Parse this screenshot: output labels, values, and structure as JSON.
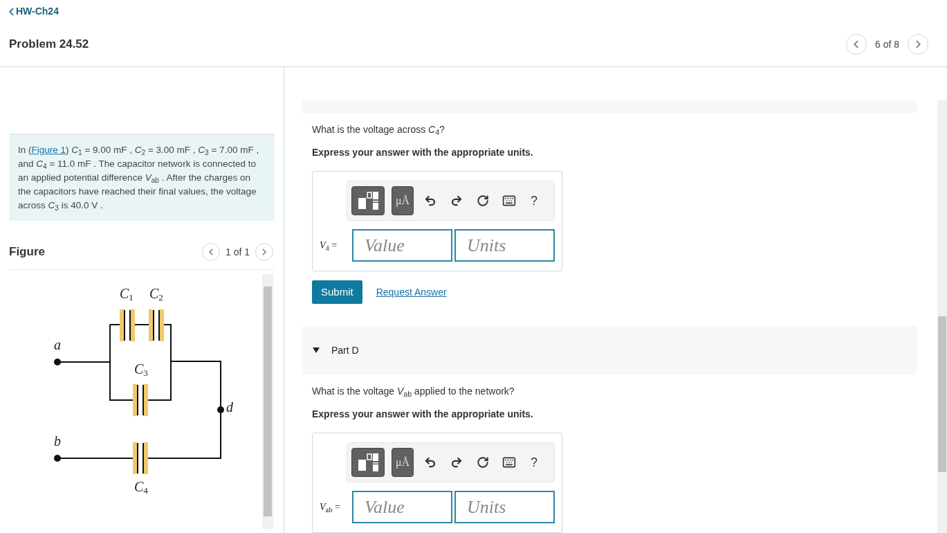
{
  "breadcrumb": "HW-Ch24",
  "problem_title": "Problem 24.52",
  "pager": "6 of 8",
  "problem": {
    "intro": "In (",
    "link": "Figure 1",
    "rest": ") *C*$_{1}$ = 9.00 mF , *C*$_{2}$ = 3.00 mF , *C*$_{3}$ = 7.00 mF , and *C*$_{4}$ = 11.0 mF . The capacitor network is connected to an applied potential difference *V*$_{ab}$ . After the charges on the capacitors have reached their final values, the voltage across *C*$_{3}$ is 40.0 V ."
  },
  "figure": {
    "title": "Figure",
    "pager": "1 of 1",
    "labels": [
      {
        "symbol": "C",
        "sub": "1"
      },
      {
        "symbol": "C",
        "sub": "2"
      },
      {
        "symbol": "C",
        "sub": "3"
      },
      {
        "symbol": "C",
        "sub": "4"
      },
      {
        "symbol": "a"
      },
      {
        "symbol": "b"
      },
      {
        "symbol": "d"
      }
    ]
  },
  "parts": [
    {
      "prompt": "What is the voltage across *C*$_{4}$?",
      "instruction": "Express your answer with the appropriate units.",
      "units_button": "μÅ",
      "help": "?",
      "variable": "*V*$_{4}$ =",
      "value_placeholder": "Value",
      "units_placeholder": "Units",
      "submit": "Submit",
      "request": "Request Answer"
    },
    {
      "header": {
        "title": "Part D",
        "expanded": true
      },
      "prompt": "What is the voltage *V*$_{ab}$ applied to the network?",
      "instruction": "Express your answer with the appropriate units.",
      "units_button": "μÅ",
      "help": "?",
      "variable": "*V*$_{ab}$ =",
      "value_placeholder": "Value",
      "units_placeholder": "Units"
    }
  ]
}
